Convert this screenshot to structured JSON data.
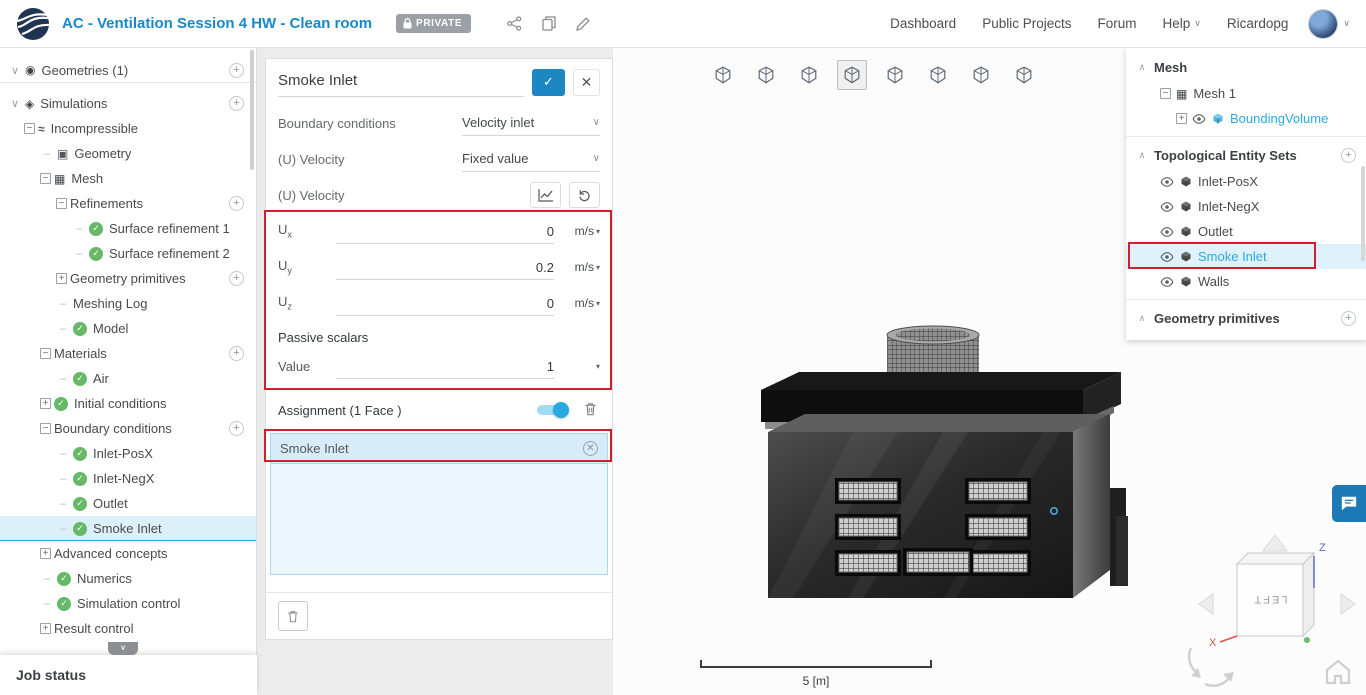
{
  "colors": {
    "accent_blue": "#2aa9e1",
    "title_blue": "#1589c9",
    "check_green": "#67b868",
    "annotation_red": "#d21f2c",
    "selected_bg": "#dff2fb"
  },
  "topbar": {
    "title": "AC - Ventilation Session 4 HW - Clean room",
    "private_label": "PRIVATE",
    "action_icons": [
      "lock-icon",
      "share-icon",
      "copy-icon",
      "edit-icon"
    ],
    "nav_items": [
      {
        "label": "Dashboard"
      },
      {
        "label": "Public Projects"
      },
      {
        "label": "Forum"
      },
      {
        "label": "Help",
        "caret": true
      },
      {
        "label": "Ricardopg"
      }
    ]
  },
  "left_tree": {
    "items": [
      {
        "label": "Geometries (1)",
        "level": 0,
        "expander": "exp-chevron",
        "icon": "icon-geometry",
        "plus": true,
        "divider_after": true
      },
      {
        "label": "Simulations",
        "level": 0,
        "expander": "exp-chevron",
        "icon": "icon-flask",
        "plus": true
      },
      {
        "label": "Incompressible",
        "level": 1,
        "expander": "exp-minus",
        "icon": "icon-incompressible"
      },
      {
        "label": "Geometry",
        "level": 2,
        "expander": "exp-dash",
        "icon": "icon-geom"
      },
      {
        "label": "Mesh",
        "level": 2,
        "expander": "exp-minus",
        "icon": "icon-mesh"
      },
      {
        "label": "Refinements",
        "level": 3,
        "expander": "exp-minus",
        "plus": true
      },
      {
        "label": "Surface refinement 1",
        "level": 4,
        "expander": "exp-dash",
        "icon": "icon-check"
      },
      {
        "label": "Surface refinement 2",
        "level": 4,
        "expander": "exp-dash",
        "icon": "icon-check"
      },
      {
        "label": "Geometry primitives",
        "level": 3,
        "expander": "exp-plus",
        "plus": true
      },
      {
        "label": "Meshing Log",
        "level": 3,
        "expander": "exp-dash"
      },
      {
        "label": "Model",
        "level": 3,
        "expander": "exp-dash",
        "icon": "icon-check"
      },
      {
        "label": "Materials",
        "level": 2,
        "expander": "exp-minus",
        "plus": true
      },
      {
        "label": "Air",
        "level": 3,
        "expander": "exp-dash",
        "icon": "icon-check"
      },
      {
        "label": "Initial conditions",
        "level": 2,
        "expander": "exp-plus",
        "icon": "icon-check"
      },
      {
        "label": "Boundary conditions",
        "level": 2,
        "expander": "exp-minus",
        "plus": true
      },
      {
        "label": "Inlet-PosX",
        "level": 3,
        "expander": "exp-dash",
        "icon": "icon-check"
      },
      {
        "label": "Inlet-NegX",
        "level": 3,
        "expander": "exp-dash",
        "icon": "icon-check"
      },
      {
        "label": "Outlet",
        "level": 3,
        "expander": "exp-dash",
        "icon": "icon-check"
      },
      {
        "label": "Smoke Inlet",
        "level": 3,
        "expander": "exp-dash",
        "icon": "icon-check",
        "row_class": "selected"
      },
      {
        "label": "Advanced concepts",
        "level": 2,
        "expander": "exp-plus"
      },
      {
        "label": "Numerics",
        "level": 2,
        "expander": "exp-dash",
        "icon": "icon-check"
      },
      {
        "label": "Simulation control",
        "level": 2,
        "expander": "exp-dash",
        "icon": "icon-check"
      },
      {
        "label": "Result control",
        "level": 2,
        "expander": "exp-plus"
      }
    ]
  },
  "job_status": {
    "label": "Job status"
  },
  "panel": {
    "title": "Smoke Inlet",
    "boundary_conditions": {
      "label": "Boundary conditions",
      "value": "Velocity inlet"
    },
    "velocity_type": {
      "label": "(U) Velocity",
      "value": "Fixed value"
    },
    "velocity_tools": {
      "label": "(U) Velocity",
      "icons": [
        "chart-icon",
        "undo-icon"
      ]
    },
    "ux": {
      "label": "U",
      "sub": "x",
      "value": "0",
      "unit": "m/s"
    },
    "uy": {
      "label": "U",
      "sub": "y",
      "value": "0.2",
      "unit": "m/s"
    },
    "uz": {
      "label": "U",
      "sub": "z",
      "value": "0",
      "unit": "m/s"
    },
    "passive_scalars": {
      "label": "Passive scalars"
    },
    "scalar_value": {
      "label": "Value",
      "value": "1"
    },
    "assignment": {
      "label": "Assignment (1 Face )",
      "chip": "Smoke Inlet"
    }
  },
  "viewport": {
    "toolbar": [
      {
        "name": "show-hide-entities-icon"
      },
      {
        "name": "solid-render-icon"
      },
      {
        "name": "translucent-render-icon"
      },
      {
        "name": "surface-mesh-render-icon",
        "active": true
      },
      {
        "name": "vertex-render-icon"
      },
      {
        "name": "transparent-surface-icon"
      },
      {
        "name": "box-selection-icon"
      },
      {
        "name": "mesh-clip-icon"
      }
    ],
    "scale_label": "5 [m]",
    "orientation": {
      "cube_label": "LEFT",
      "axis_x": "X",
      "axis_z": "Z"
    }
  },
  "right_tree": {
    "mesh_section": {
      "title": "Mesh"
    },
    "mesh_items": [
      {
        "label": "Mesh 1",
        "level": 1,
        "expander": "exp-minus",
        "icon": "icon-mesh"
      },
      {
        "label": "BoundingVolume",
        "level": 2,
        "expander": "exp-plus",
        "eye": true,
        "cube": true,
        "row_class": "blue-label"
      }
    ],
    "topo_section": {
      "title": "Topological Entity Sets",
      "plus": true
    },
    "topo_items": [
      {
        "label": "Inlet-PosX",
        "level": 1,
        "eye": true,
        "cube": true
      },
      {
        "label": "Inlet-NegX",
        "level": 1,
        "eye": true,
        "cube": true
      },
      {
        "label": "Outlet",
        "level": 1,
        "eye": true,
        "cube": true
      },
      {
        "label": "Smoke Inlet",
        "level": 1,
        "eye": true,
        "cube": true,
        "row_class": "selected"
      },
      {
        "label": "Walls",
        "level": 1,
        "eye": true,
        "cube": true
      }
    ],
    "primitives_section": {
      "title": "Geometry primitives",
      "plus": true
    }
  }
}
